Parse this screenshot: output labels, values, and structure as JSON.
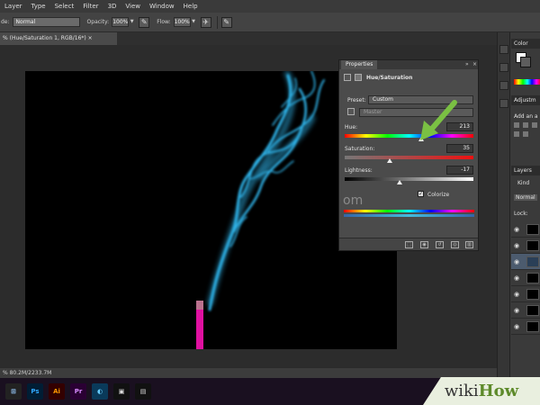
{
  "menubar": {
    "items": [
      "Layer",
      "Type",
      "Select",
      "Filter",
      "3D",
      "View",
      "Window",
      "Help"
    ]
  },
  "options_bar": {
    "mode_label": "de:",
    "mode_value": "Normal",
    "opacity_label": "Opacity:",
    "opacity_value": "100%",
    "flow_label": "Flow:",
    "flow_value": "100%"
  },
  "document": {
    "tab_title": "% (Hue/Saturation 1, RGB/16*) ×",
    "status_text": "% 80.2M/2233.7M"
  },
  "properties_panel": {
    "tab": "Properties",
    "adjustment_title": "Hue/Saturation",
    "preset_label": "Preset:",
    "preset_value": "Custom",
    "channel_value": "Master",
    "hue_label": "Hue:",
    "hue_value": "213",
    "saturation_label": "Saturation:",
    "saturation_value": "35",
    "lightness_label": "Lightness:",
    "lightness_value": "-17",
    "colorize_label": "Colorize",
    "colorize_checked": true,
    "range_label": "om"
  },
  "right_panels": {
    "color_tab": "Color",
    "adjustments_tab": "Adjustm",
    "adjustments_add": "Add an a",
    "layers_tab": "Layers",
    "kind_filter": "Kind",
    "blend_mode": "Normal",
    "lock_label": "Lock:"
  },
  "taskbar": {
    "icons": [
      "Ps",
      "Ai",
      "Pr"
    ]
  },
  "watermark": {
    "wiki": "wiki",
    "how": "How"
  },
  "colors": {
    "smoke": "#2fb1e6",
    "incense_stick": "#e010a0",
    "arrow": "#7ac043",
    "canvas": "#000000"
  }
}
